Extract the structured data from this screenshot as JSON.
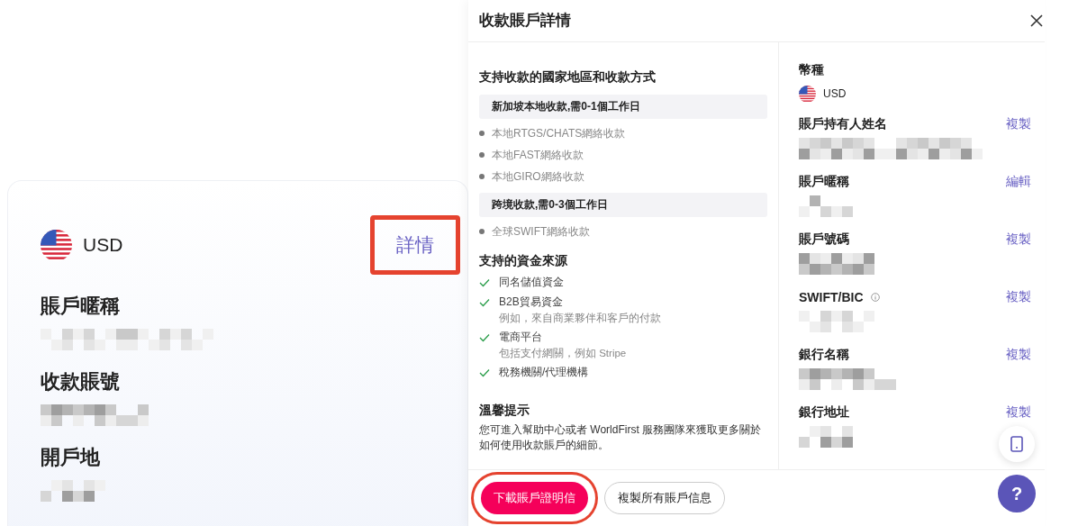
{
  "account_card": {
    "currency": "USD",
    "details_link": {
      "label": "詳情",
      "highlighted": true
    },
    "fields": [
      {
        "label": "賬戶暱稱"
      },
      {
        "label": "收款賬號"
      },
      {
        "label": "開戶地"
      }
    ]
  },
  "drawer": {
    "title": "收款賬戶詳情",
    "methods_title": "支持收款的國家地區和收款方式",
    "method_groups": [
      {
        "title": "新加坡本地收款,需0-1個工作日",
        "items": [
          "本地RTGS/CHATS網絡收款",
          "本地FAST網絡收款",
          "本地GIRO網絡收款"
        ]
      },
      {
        "title": "跨境收款,需0-3個工作日",
        "items": [
          "全球SWIFT網絡收款"
        ]
      }
    ],
    "sources_title": "支持的資金來源",
    "sources": [
      {
        "label": "同名儲值資金"
      },
      {
        "label": "B2B貿易資金",
        "note": "例如，來自商業夥伴和客戶的付款"
      },
      {
        "label": "電商平台",
        "note": "包括支付網關，例如 Stripe"
      },
      {
        "label": "稅務機關/代理機構"
      }
    ],
    "tip_title": "溫馨提示",
    "tip_text": "您可進入幫助中心或者 WorldFirst 服務團隊來獲取更多關於如何使用收款賬戶的細節。",
    "currency_label": "幣種",
    "currency": "USD",
    "fields": [
      {
        "label": "賬戶持有人姓名",
        "action": "複製",
        "info": false
      },
      {
        "label": "賬戶暱稱",
        "action": "編輯",
        "info": false
      },
      {
        "label": "賬戶號碼",
        "action": "複製",
        "info": false
      },
      {
        "label": "SWIFT/BIC",
        "action": "複製",
        "info": true
      },
      {
        "label": "銀行名稱",
        "action": "複製",
        "info": false
      },
      {
        "label": "銀行地址",
        "action": "複製",
        "info": false
      }
    ],
    "buttons": [
      {
        "label": "下載賬戶證明信",
        "kind": "primary",
        "highlighted": true
      },
      {
        "label": "複製所有賬戶信息",
        "kind": "secondary",
        "highlighted": false
      }
    ]
  },
  "help_button": "?"
}
